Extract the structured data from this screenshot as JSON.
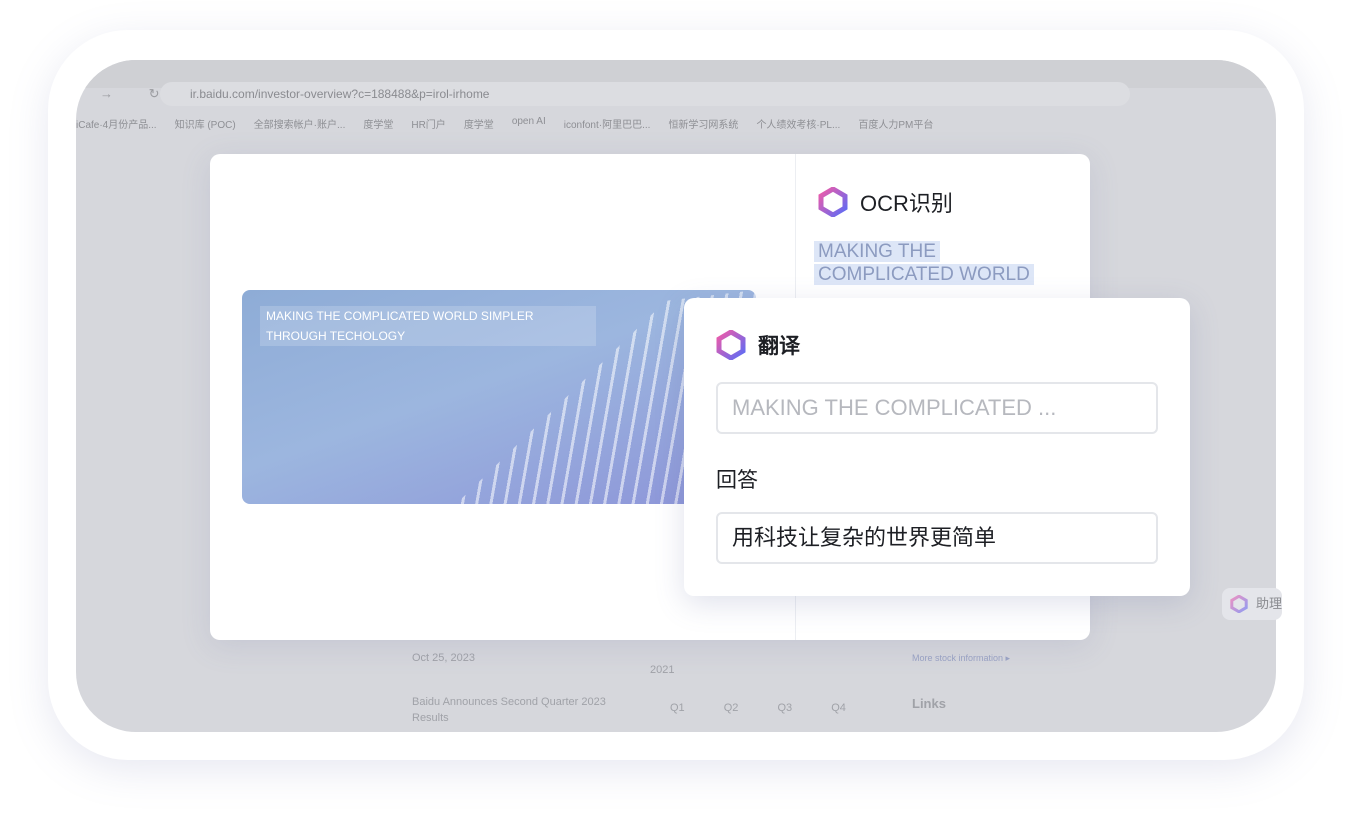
{
  "browser": {
    "url": "ir.baidu.com/investor-overview?c=188488&p=irol-irhome",
    "bookmarks": [
      "iCafe·4月份产品...",
      "知识库 (POC)",
      "全部搜索帐户·账户...",
      "度学堂",
      "HR门户",
      "度学堂",
      "open AI",
      "iconfont·阿里巴巴...",
      "恒新学习网系统",
      "个人绩效考核·PL...",
      "百度人力PM平台"
    ]
  },
  "background": {
    "date": "Oct 25, 2023",
    "year": "2021",
    "news": "Baidu Announces Second Quarter 2023 Results",
    "quarters": [
      "Q1",
      "Q2",
      "Q3",
      "Q4"
    ],
    "more_stock": "More stock information ▸",
    "links": "Links",
    "assistant": "助理"
  },
  "image_caption": "MAKING THE COMPLICATED WORLD SIMPLER THROUGH TECHOLOGY",
  "ocr": {
    "title": "OCR识别",
    "line1": "MAKING THE",
    "line2": "COMPLICATED WORLD"
  },
  "translate": {
    "title": "翻译",
    "input": "MAKING THE COMPLICATED ...",
    "answer_label": "回答",
    "answer": "用科技让复杂的世界更简单"
  },
  "colors": {
    "accent_highlight": "#dde6f7",
    "logo_start": "#6c5cf6",
    "logo_end": "#f05aa8"
  }
}
